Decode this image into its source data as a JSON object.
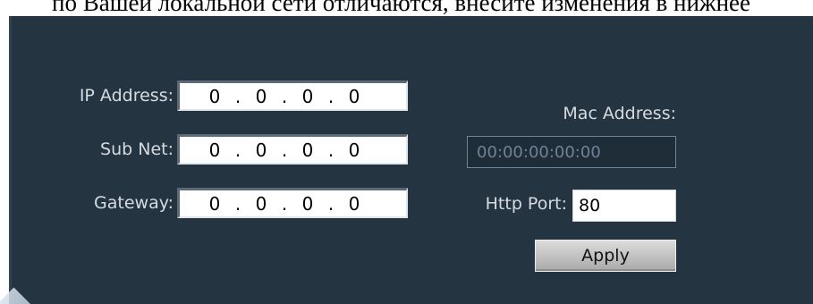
{
  "header_text": "по Вашей локальной сети отличаются, внесите изменения в нижнее",
  "network": {
    "ip_label": "IP Address:",
    "ip_octets": [
      "0",
      "0",
      "0",
      "0"
    ],
    "subnet_label": "Sub Net:",
    "subnet_octets": [
      "0",
      "0",
      "0",
      "0"
    ],
    "gateway_label": "Gateway:",
    "gateway_octets": [
      "0",
      "0",
      "0",
      "0"
    ],
    "dot": "."
  },
  "mac": {
    "label": "Mac Address:",
    "value": "00:00:00:00:00"
  },
  "http": {
    "label": "Http Port:",
    "value": "80"
  },
  "apply_label": "Apply",
  "colors": {
    "panel_bg": "#243441",
    "label_text": "#d6dbe0",
    "mac_text": "#6f8394"
  }
}
